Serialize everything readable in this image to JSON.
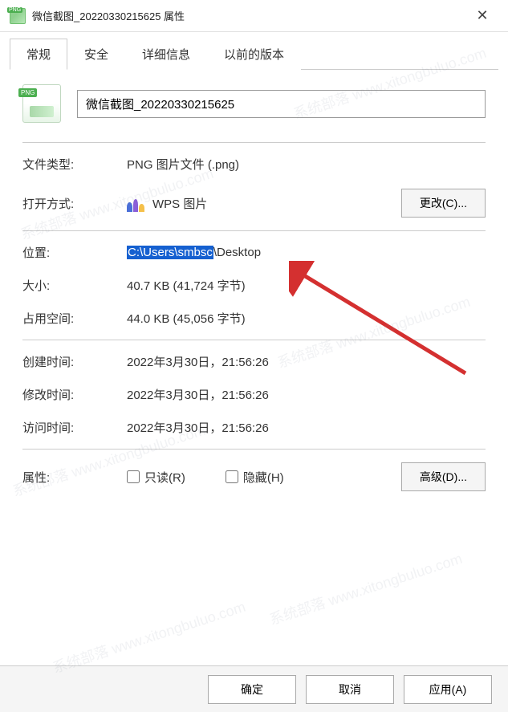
{
  "window": {
    "title": "微信截图_20220330215625 属性"
  },
  "tabs": {
    "general": "常规",
    "security": "安全",
    "details": "详细信息",
    "previous": "以前的版本"
  },
  "filename": "微信截图_20220330215625",
  "fields": {
    "filetype_label": "文件类型:",
    "filetype_value": "PNG 图片文件 (.png)",
    "openwith_label": "打开方式:",
    "openwith_value": "WPS 图片",
    "change_btn": "更改(C)...",
    "location_label": "位置:",
    "location_highlight": "C:\\Users\\smbsc",
    "location_rest": "\\Desktop",
    "size_label": "大小:",
    "size_value": "40.7 KB (41,724 字节)",
    "sizeondisk_label": "占用空间:",
    "sizeondisk_value": "44.0 KB (45,056 字节)",
    "created_label": "创建时间:",
    "created_value": "2022年3月30日，21:56:26",
    "modified_label": "修改时间:",
    "modified_value": "2022年3月30日，21:56:26",
    "accessed_label": "访问时间:",
    "accessed_value": "2022年3月30日，21:56:26",
    "attributes_label": "属性:",
    "readonly_label": "只读(R)",
    "hidden_label": "隐藏(H)",
    "advanced_btn": "高级(D)..."
  },
  "buttons": {
    "ok": "确定",
    "cancel": "取消",
    "apply": "应用(A)"
  },
  "watermark": "系统部落 www.xitongbuluo.com"
}
